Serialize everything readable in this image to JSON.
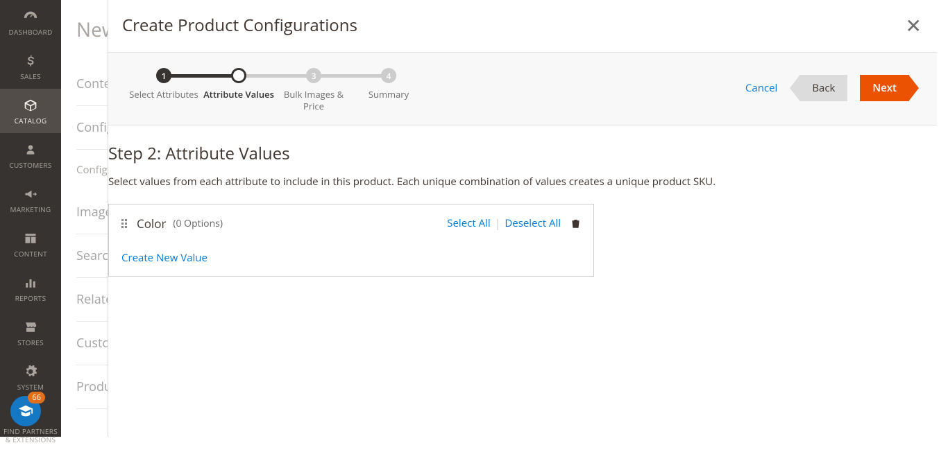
{
  "sidebar": {
    "items": [
      {
        "label": "DASHBOARD"
      },
      {
        "label": "SALES"
      },
      {
        "label": "CATALOG"
      },
      {
        "label": "CUSTOMERS"
      },
      {
        "label": "MARKETING"
      },
      {
        "label": "CONTENT"
      },
      {
        "label": "REPORTS"
      },
      {
        "label": "STORES"
      },
      {
        "label": "SYSTEM"
      },
      {
        "label": "FIND PARTNERS & EXTENSIONS"
      }
    ],
    "active_index": 2,
    "help_badge": "66"
  },
  "page": {
    "title": "New Product",
    "sections": [
      "Content",
      "Configurations",
      "Images And Videos",
      "Search Engine Optimization",
      "Related Products, Up-Sells, and Cross-Sells",
      "Customizable Options",
      "Product in Websites"
    ],
    "config_hint": "Configurable products allow customers to choose options (Ex: shirt color). You need to create a simple product for each configuration (Ex: a product for each color)."
  },
  "modal": {
    "title": "Create Product Configurations",
    "actions": {
      "cancel": "Cancel",
      "back": "Back",
      "next": "Next"
    },
    "wizard": {
      "steps": [
        {
          "num": "1",
          "label": "Select Attributes"
        },
        {
          "num": "2",
          "label": "Attribute Values"
        },
        {
          "num": "3",
          "label": "Bulk Images & Price"
        },
        {
          "num": "4",
          "label": "Summary"
        }
      ],
      "current_index": 1
    },
    "step": {
      "title": "Step 2: Attribute Values",
      "description": "Select values from each attribute to include in this product. Each unique combination of values creates a unique product SKU."
    },
    "attribute_card": {
      "name": "Color",
      "options_count": "(0 Options)",
      "select_all": "Select All",
      "deselect_all": "Deselect All",
      "create_new": "Create New Value"
    }
  }
}
